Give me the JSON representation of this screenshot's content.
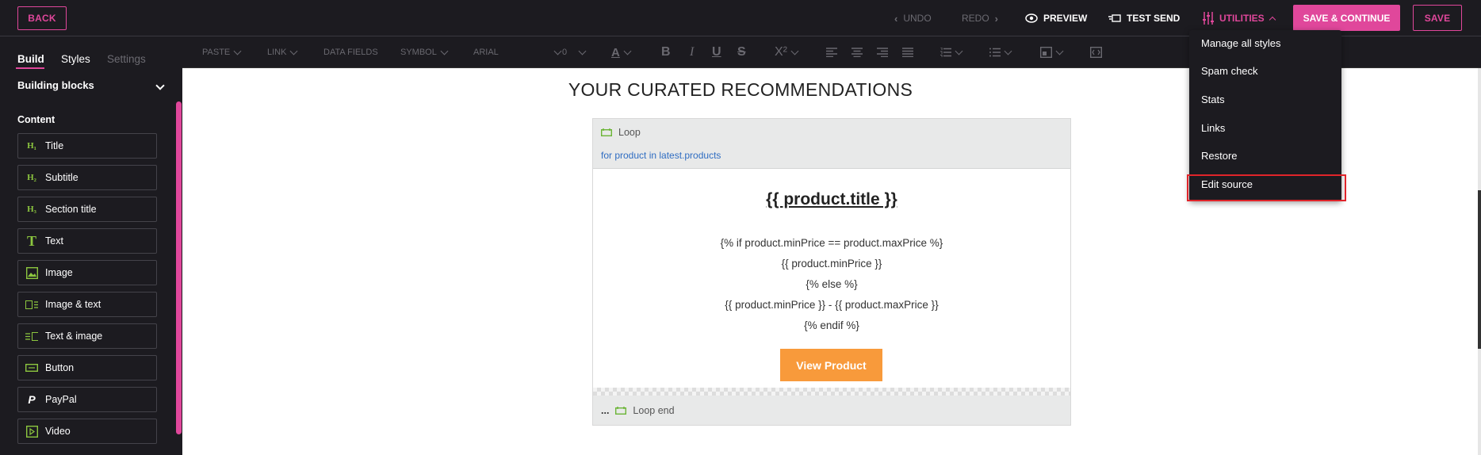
{
  "topbar": {
    "back": "BACK",
    "undo": "UNDO",
    "redo": "REDO",
    "preview": "PREVIEW",
    "test_send": "TEST SEND",
    "utilities": "UTILITIES",
    "save_continue": "SAVE & CONTINUE",
    "save": "SAVE"
  },
  "toolbar": {
    "paste": "PASTE",
    "link": "LINK",
    "data_fields": "DATA FIELDS",
    "symbol": "SYMBOL",
    "font": "ARIAL",
    "size": "0",
    "color": "A",
    "bold": "B",
    "italic": "I",
    "underline": "U",
    "strike": "S",
    "superscript": "X²"
  },
  "sidebar": {
    "tabs": [
      "Build",
      "Styles",
      "Settings"
    ],
    "section_title": "Building blocks",
    "content_label": "Content",
    "blocks": [
      {
        "icon": "heading1-icon",
        "glyph": "H₁",
        "label": "Title"
      },
      {
        "icon": "heading2-icon",
        "glyph": "H₂",
        "label": "Subtitle"
      },
      {
        "icon": "heading3-icon",
        "glyph": "H₃",
        "label": "Section title"
      },
      {
        "icon": "text-icon",
        "glyph": "T",
        "label": "Text"
      },
      {
        "icon": "image-icon",
        "glyph": "",
        "label": "Image"
      },
      {
        "icon": "image-text-icon",
        "glyph": "",
        "label": "Image & text"
      },
      {
        "icon": "text-image-icon",
        "glyph": "",
        "label": "Text & image"
      },
      {
        "icon": "button-icon",
        "glyph": "",
        "label": "Button"
      },
      {
        "icon": "paypal-icon",
        "glyph": "",
        "label": "PayPal"
      },
      {
        "icon": "video-icon",
        "glyph": "",
        "label": "Video"
      }
    ]
  },
  "canvas": {
    "heading": "YOUR CURATED RECOMMENDATIONS",
    "loop_label": "Loop",
    "loop_expression": "for product in latest.products",
    "product_title": "{{ product.title }}",
    "code_lines": [
      "{% if product.minPrice == product.maxPrice %}",
      "{{ product.minPrice }}",
      "{% else %}",
      "{{ product.minPrice }} - {{ product.maxPrice }}",
      "{% endif %}"
    ],
    "button": "View Product",
    "loop_end_dots": "...",
    "loop_end": "Loop end"
  },
  "utilities_menu": {
    "items": [
      "Manage all styles",
      "Spam check",
      "Stats",
      "Links",
      "Restore",
      "Edit source"
    ],
    "highlighted": "Edit source"
  },
  "colors": {
    "accent": "#e0479b",
    "dark": "#1c1b20",
    "button": "#f89a3b",
    "link": "#2f6dc2",
    "highlight": "#e0242a"
  }
}
